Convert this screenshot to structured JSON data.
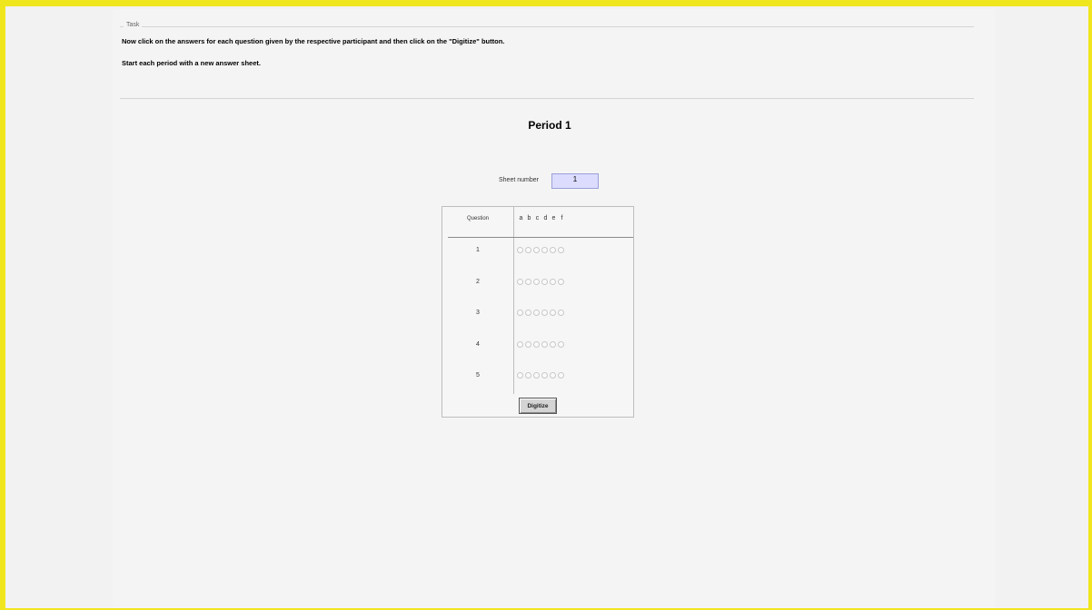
{
  "task": {
    "legend": "Task",
    "instruction_1": "Now click on the answers for each question given by the respective participant and then click on the \"Digitize\" button.",
    "instruction_2": "Start each period with a new answer sheet."
  },
  "period": {
    "title": "Period 1"
  },
  "sheet": {
    "label": "Sheet number",
    "value": "1"
  },
  "answer_table": {
    "question_header": "Question",
    "answer_letters": [
      "a",
      "b",
      "c",
      "d",
      "e",
      "f"
    ],
    "questions": [
      {
        "number": "1"
      },
      {
        "number": "2"
      },
      {
        "number": "3"
      },
      {
        "number": "4"
      },
      {
        "number": "5"
      }
    ],
    "digitize_label": "Digitize"
  },
  "colors": {
    "frame_border": "#f0e61e",
    "sheet_input_bg": "#dcdcff"
  }
}
